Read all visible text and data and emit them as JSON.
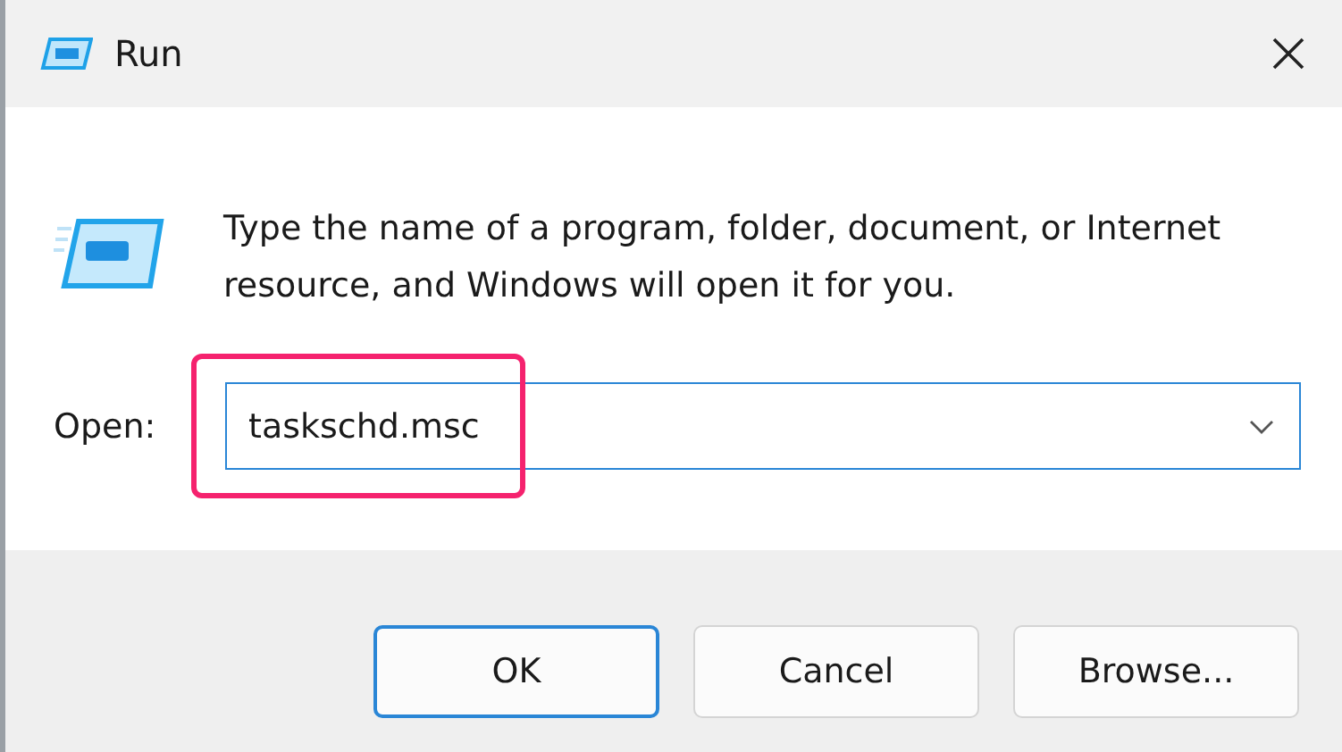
{
  "window": {
    "title": "Run"
  },
  "description": "Type the name of a program, folder, document, or Internet resource, and Windows will open it for you.",
  "open_field": {
    "label": "Open:",
    "value": "taskschd.msc",
    "highlighted": true
  },
  "buttons": [
    {
      "label": "OK",
      "default": true
    },
    {
      "label": "Cancel",
      "default": false
    },
    {
      "label": "Browse...",
      "default": false
    }
  ]
}
